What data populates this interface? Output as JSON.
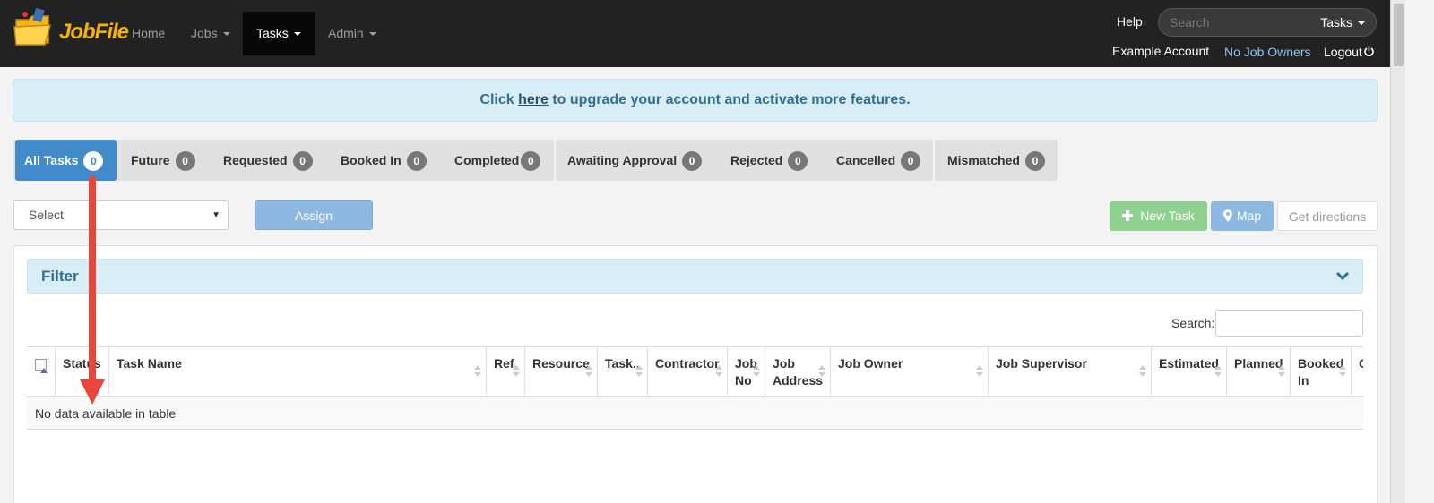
{
  "navbar": {
    "brand": "JobFile",
    "items": [
      {
        "label": "Home",
        "caret": false
      },
      {
        "label": "Jobs",
        "caret": true
      },
      {
        "label": "Tasks",
        "caret": true,
        "active": true
      },
      {
        "label": "Admin",
        "caret": true
      }
    ],
    "help": "Help",
    "search_placeholder": "Search",
    "search_scope": "Tasks",
    "account": "Example Account",
    "job_owners_link": "No Job Owners",
    "logout": "Logout"
  },
  "alert": {
    "prefix": "Click ",
    "link": "here",
    "suffix": " to upgrade your account and activate more features."
  },
  "tabs": [
    {
      "label": "All Tasks",
      "count": "0",
      "active": true
    },
    {
      "label": "Future",
      "count": "0"
    },
    {
      "label": "Requested",
      "count": "0"
    },
    {
      "label": "Booked In",
      "count": "0"
    },
    {
      "label": "Completed",
      "count": "0"
    },
    {
      "label": "Awaiting Approval",
      "count": "0"
    },
    {
      "label": "Rejected",
      "count": "0"
    },
    {
      "label": "Cancelled",
      "count": "0"
    },
    {
      "label": "Mismatched",
      "count": "0"
    }
  ],
  "controls": {
    "select_value": "Select",
    "assign": "Assign",
    "new_task": "New Task",
    "map": "Map",
    "get_directions": "Get directions"
  },
  "panel": {
    "filter_title": "Filter",
    "search_label": "Search:"
  },
  "table": {
    "columns": [
      "Status",
      "Task Name",
      "Ref.",
      "Resource",
      "Task..",
      "Contractor",
      "Job No",
      "Job Address",
      "Job Owner",
      "Job Supervisor",
      "Estimated",
      "Planned",
      "Booked In",
      "C"
    ],
    "empty_message": "No data available in table"
  },
  "colors": {
    "navbar_bg": "#222222",
    "primary": "#428bca",
    "success": "#8fd18f",
    "info_bg": "#d9edf7",
    "info_text": "#31708f",
    "annotation_arrow": "#e8463a"
  }
}
